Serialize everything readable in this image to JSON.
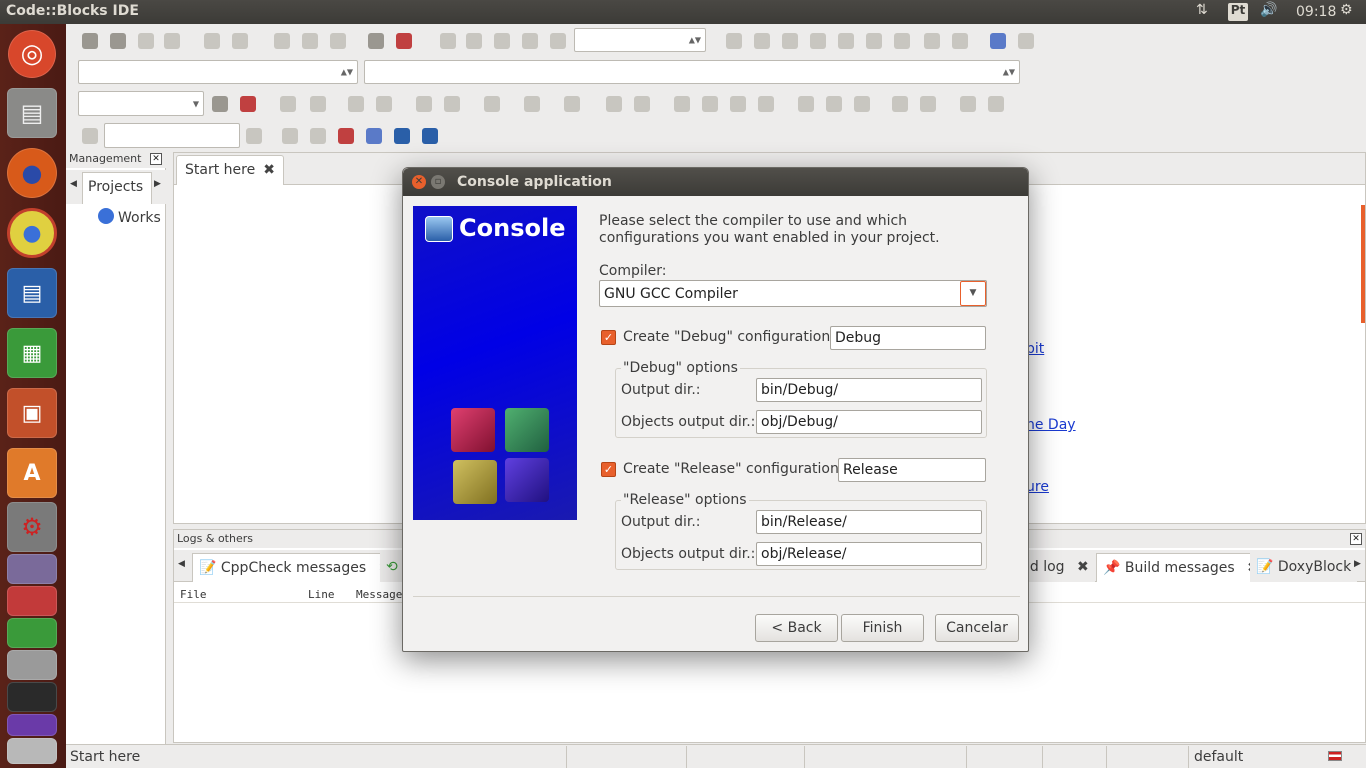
{
  "topbar": {
    "title": "Code::Blocks IDE",
    "keyboard": "Pt",
    "time": "09:18"
  },
  "launcher": {
    "items": [
      "ubuntu-icon",
      "files-icon",
      "firefox-icon",
      "chrome-icon",
      "writer-icon",
      "calc-icon",
      "impress-icon",
      "software-center-icon",
      "system-settings-icon",
      "app-icon-1",
      "app-icon-2",
      "app-icon-3",
      "app-icon-4",
      "app-icon-5",
      "app-icon-6",
      "app-icon-7"
    ]
  },
  "management": {
    "title": "Management",
    "tab": "Projects",
    "workspace": "Works"
  },
  "editor": {
    "tab": "Start here",
    "links": [
      " bit",
      "he Day",
      "ure "
    ]
  },
  "logs": {
    "title": "Logs & others",
    "tabs": [
      "CppCheck messages",
      "ld log",
      "Build messages",
      "DoxyBlock"
    ],
    "columns": [
      "File",
      "Line",
      "Message"
    ]
  },
  "statusbar": {
    "left": "Start here",
    "right": "default"
  },
  "dialog": {
    "title": "Console application",
    "banner": "Console",
    "intro": "Please select the compiler to use and which configurations you want enabled in your project.",
    "compiler_label": "Compiler:",
    "compiler_value": "GNU GCC Compiler",
    "debug": {
      "check_label": "Create \"Debug\" configuration:",
      "name": "Debug",
      "group": "\"Debug\" options",
      "output_label": "Output dir.:",
      "output": "bin/Debug/",
      "objects_label": "Objects output dir.:",
      "objects": "obj/Debug/"
    },
    "release": {
      "check_label": "Create \"Release\" configuration:",
      "name": "Release",
      "group": "\"Release\" options",
      "output_label": "Output dir.:",
      "output": "bin/Release/",
      "objects_label": "Objects output dir.:",
      "objects": "obj/Release/"
    },
    "buttons": {
      "back": "< Back",
      "finish": "Finish",
      "cancel": "Cancelar"
    }
  },
  "colors": {
    "launcher": "#5a2218",
    "accent": "#e8602c",
    "banner": "#0000e6",
    "link": "#1a3ad0"
  }
}
